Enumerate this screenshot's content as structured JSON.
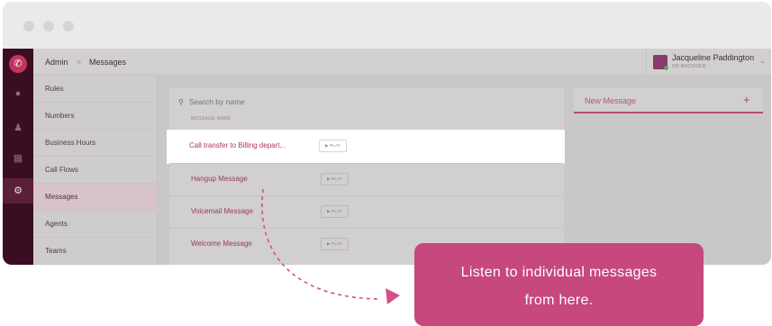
{
  "breadcrumb": {
    "root": "Admin",
    "separator": "»",
    "current": "Messages"
  },
  "user": {
    "name": "Jacqueline Paddington",
    "status": "ON BROWSER"
  },
  "rail_icons": [
    "phone-icon",
    "microphone-icon",
    "people-icon",
    "keypad-icon",
    "gear-icon"
  ],
  "subnav": {
    "items": [
      {
        "label": "Rules"
      },
      {
        "label": "Numbers"
      },
      {
        "label": "Business Hours"
      },
      {
        "label": "Call Flows"
      },
      {
        "label": "Messages"
      },
      {
        "label": "Agents"
      },
      {
        "label": "Teams"
      }
    ]
  },
  "messages": {
    "search_placeholder": "Search by name",
    "column_header": "MESSAGE NAME",
    "play_label": "▶ PLAY",
    "rows": [
      {
        "name": "Call transfer to Billing depart..."
      },
      {
        "name": "Hangup Message"
      },
      {
        "name": "Voicemail Message"
      },
      {
        "name": "Welcome Message"
      }
    ]
  },
  "new_message": {
    "label": "New Message",
    "plus": "+"
  },
  "callout": {
    "line1": "Listen to individual messages",
    "line2": "from here."
  },
  "colors": {
    "accent": "#c6487c",
    "rail": "#3a0d22",
    "highlight_text": "#b5335e"
  }
}
